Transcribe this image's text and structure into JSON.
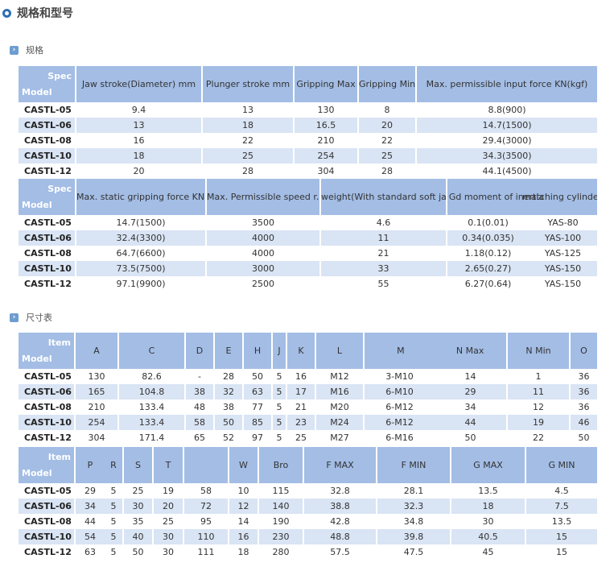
{
  "page_title": "规格和型号",
  "sections": [
    {
      "label": "规格"
    },
    {
      "label": "尺寸表"
    }
  ],
  "colors": {
    "header_bg": "#a3bde5",
    "row_alt": "#d9e4f4",
    "accent": "#2f6fb5"
  },
  "tables": [
    {
      "corner_top": "Spec",
      "corner_bottom": "Model",
      "headers": [
        "Jaw stroke(Diameter) mm",
        "Plunger stroke mm",
        "Gripping Max",
        "Gripping Min",
        "Max. permissible input force KN(kgf)"
      ],
      "rows": [
        [
          "CASTL-05",
          "9.4",
          "13",
          "130",
          "8",
          "8.8(900)"
        ],
        [
          "CASTL-06",
          "13",
          "18",
          "16.5",
          "20",
          "14.7(1500)"
        ],
        [
          "CASTL-08",
          "16",
          "22",
          "210",
          "22",
          "29.4(3000)"
        ],
        [
          "CASTL-10",
          "18",
          "25",
          "254",
          "25",
          "34.3(3500)"
        ],
        [
          "CASTL-12",
          "20",
          "28",
          "304",
          "28",
          "44.1(4500)"
        ]
      ]
    },
    {
      "corner_top": "Spec",
      "corner_bottom": "Model",
      "headers": [
        "Max. static gripping force KN(kgf)",
        "Max. Permissible speed r.p.m",
        "weight(With standard soft jaws)",
        "Gd moment of inertia",
        "matching cylinder"
      ],
      "rows": [
        [
          "CASTL-05",
          "14.7(1500)",
          "3500",
          "4.6",
          "0.1(0.01)",
          "YAS-80"
        ],
        [
          "CASTL-06",
          "32.4(3300)",
          "4000",
          "11",
          "0.34(0.035)",
          "YAS-100"
        ],
        [
          "CASTL-08",
          "64.7(6600)",
          "4000",
          "21",
          "1.18(0.12)",
          "YAS-125"
        ],
        [
          "CASTL-10",
          "73.5(7500)",
          "3000",
          "33",
          "2.65(0.27)",
          "YAS-150"
        ],
        [
          "CASTL-12",
          "97.1(9900)",
          "2500",
          "55",
          "6.27(0.64)",
          "YAS-150"
        ]
      ]
    },
    {
      "corner_top": "Item",
      "corner_bottom": "Model",
      "headers": [
        "A",
        "C",
        "D",
        "E",
        "H",
        "J",
        "K",
        "L",
        "M",
        "N Max",
        "N Min",
        "O"
      ],
      "rows": [
        [
          "CASTL-05",
          "130",
          "82.6",
          "-",
          "28",
          "50",
          "5",
          "16",
          "M12",
          "3-M10",
          "14",
          "1",
          "36"
        ],
        [
          "CASTL-06",
          "165",
          "104.8",
          "38",
          "32",
          "63",
          "5",
          "17",
          "M16",
          "6-M10",
          "29",
          "11",
          "36"
        ],
        [
          "CASTL-08",
          "210",
          "133.4",
          "48",
          "38",
          "77",
          "5",
          "21",
          "M20",
          "6-M12",
          "34",
          "12",
          "36"
        ],
        [
          "CASTL-10",
          "254",
          "133.4",
          "58",
          "50",
          "85",
          "5",
          "23",
          "M24",
          "6-M12",
          "44",
          "19",
          "46"
        ],
        [
          "CASTL-12",
          "304",
          "171.4",
          "65",
          "52",
          "97",
          "5",
          "25",
          "M27",
          "6-M16",
          "50",
          "22",
          "50"
        ]
      ]
    },
    {
      "corner_top": "Item",
      "corner_bottom": "Model",
      "headers": [
        "P",
        "R",
        "S",
        "T",
        "",
        "W",
        "Bro",
        "F MAX",
        "F MIN",
        "G MAX",
        "G MIN"
      ],
      "rows": [
        [
          "CASTL-05",
          "29",
          "5",
          "25",
          "19",
          "58",
          "10",
          "115",
          "32.8",
          "28.1",
          "13.5",
          "4.5"
        ],
        [
          "CASTL-06",
          "34",
          "5",
          "30",
          "20",
          "72",
          "12",
          "140",
          "38.8",
          "32.3",
          "18",
          "7.5"
        ],
        [
          "CASTL-08",
          "44",
          "5",
          "35",
          "25",
          "95",
          "14",
          "190",
          "42.8",
          "34.8",
          "30",
          "13.5"
        ],
        [
          "CASTL-10",
          "54",
          "5",
          "40",
          "30",
          "110",
          "16",
          "230",
          "48.8",
          "39.8",
          "40.5",
          "15"
        ],
        [
          "CASTL-12",
          "63",
          "5",
          "50",
          "30",
          "111",
          "18",
          "280",
          "57.5",
          "47.5",
          "45",
          "15"
        ]
      ]
    }
  ]
}
